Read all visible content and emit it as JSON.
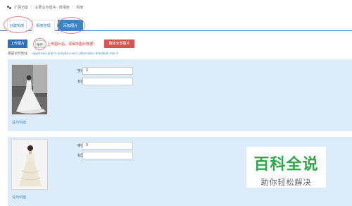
{
  "breadcrumb": [
    "扩展功能",
    "主要业务模块 - 微相册",
    "相册"
  ],
  "tabs": [
    {
      "label": "创建相册",
      "active": false
    },
    {
      "label": "相册管理",
      "active": false
    },
    {
      "label": "添加图片",
      "active": true
    }
  ],
  "actions": {
    "upload_label": "上传图片",
    "save_label": "保存",
    "hint": "上传图片后，请保存图片数据！",
    "delete_all_label": "删除全部图片"
  },
  "album_url": {
    "label": "相册访问地址：",
    "value": "/app/index.php?i=entry&m=we7_album&do=detail&id=4&i=3"
  },
  "photos": [
    {
      "sort_label": "排序",
      "sort_value": "0",
      "title_label": "标题",
      "title_value": "",
      "set_cover": "设为封面"
    },
    {
      "sort_label": "排序",
      "sort_value": "0",
      "title_label": "标题",
      "title_value": "",
      "set_cover": "设为封面"
    }
  ],
  "watermark": {
    "title": "百科全说",
    "subtitle": "助你轻松解决"
  },
  "colors": {
    "primary": "#3a85c6",
    "danger": "#d9534f",
    "hint": "#d0302a",
    "card_bg": "#dcecf8",
    "watermark_green": "#2fa74a"
  }
}
